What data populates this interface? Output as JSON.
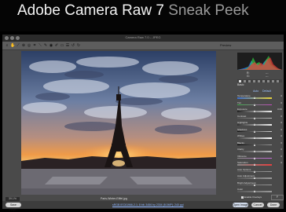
{
  "banner": {
    "title": "Adobe Camera Raw 7",
    "subtitle": "Sneak Peek"
  },
  "window": {
    "title": "Camera Raw 7.0 – JPEG"
  },
  "toolbar": {
    "tools": [
      "zoom-icon",
      "hand-icon",
      "white-balance-icon",
      "color-sampler-icon",
      "targeted-adjust-icon",
      "crop-icon",
      "straighten-icon",
      "spot-removal-icon",
      "red-eye-icon",
      "adjustment-brush-icon",
      "graduated-filter-icon",
      "preferences-icon",
      "rotate-left-icon",
      "rotate-right-icon"
    ],
    "preview_label": "Preview"
  },
  "canvas": {
    "zoom": "39.1%",
    "file_name": "Paris-Winter-Eiffel.jpg"
  },
  "histogram": {
    "rgb_labels": [
      "R:",
      "G:",
      "B:"
    ],
    "rgb_values": [
      "---",
      "---",
      "---"
    ]
  },
  "panel": {
    "section": "Basic",
    "auto": "Auto",
    "default": "Default",
    "sliders": [
      {
        "label": "Temperature",
        "value": "0",
        "position": 0.5,
        "gradient": "linear-gradient(90deg,#3a6fd1,#e8d23a)"
      },
      {
        "label": "Tint",
        "value": "0",
        "position": 0.5,
        "gradient": "linear-gradient(90deg,#3cb34a,#c44bbf)"
      },
      {
        "label": "Exposure",
        "value": "0.00",
        "position": 0.5,
        "gradient": "linear-gradient(90deg,#222,#eee)"
      },
      {
        "label": "Contrast",
        "value": "0",
        "position": 0.5,
        "gradient": "linear-gradient(90deg,#555,#bbb)"
      },
      {
        "label": "Highlights",
        "value": "0",
        "position": 0.5,
        "gradient": "linear-gradient(90deg,#333,#eee)"
      },
      {
        "label": "Shadows",
        "value": "0",
        "position": 0.5,
        "gradient": "linear-gradient(90deg,#111,#ccc)"
      },
      {
        "label": "Whites",
        "value": "0",
        "position": 0.5,
        "gradient": "linear-gradient(90deg,#444,#fff)"
      },
      {
        "label": "Blacks",
        "value": "0",
        "position": 0.5,
        "gradient": "linear-gradient(90deg,#000,#999)"
      },
      {
        "label": "Clarity",
        "value": "0",
        "position": 0.5,
        "gradient": "linear-gradient(90deg,#444,#bbb)"
      },
      {
        "label": "Vibrance",
        "value": "0",
        "position": 0.5,
        "gradient": "linear-gradient(90deg,#888,#c46ad6)"
      },
      {
        "label": "Saturation",
        "value": "0",
        "position": 0.5,
        "gradient": "linear-gradient(90deg,#888,#e24040)"
      }
    ],
    "extra_sliders": [
      {
        "label": "Auto Options",
        "value": "",
        "position": 0.5,
        "gradient": "linear-gradient(90deg,#555,#999)"
      },
      {
        "label": "Auto Adjustment",
        "value": "",
        "position": 0.5,
        "gradient": "linear-gradient(90deg,#555,#999)"
      },
      {
        "label": "Bright Adjustment",
        "value": "",
        "position": 0.5,
        "gradient": "linear-gradient(90deg,#555,#999)"
      },
      {
        "label": "Color",
        "value": "",
        "position": 0.5,
        "gradient": "linear-gradient(90deg,#555,#999)"
      }
    ],
    "fullscreen": "F"
  },
  "bottom": {
    "save_button": "Save Image...",
    "workflow_link": "sRGB IEC61966-2.1; 8 bit; 3456 by 2304 (8.0MP); 240 ppi",
    "open_button": "Open Image",
    "cancel_button": "Cancel",
    "done_button": "Done",
    "checkbox_label": "Enable Overlays"
  }
}
